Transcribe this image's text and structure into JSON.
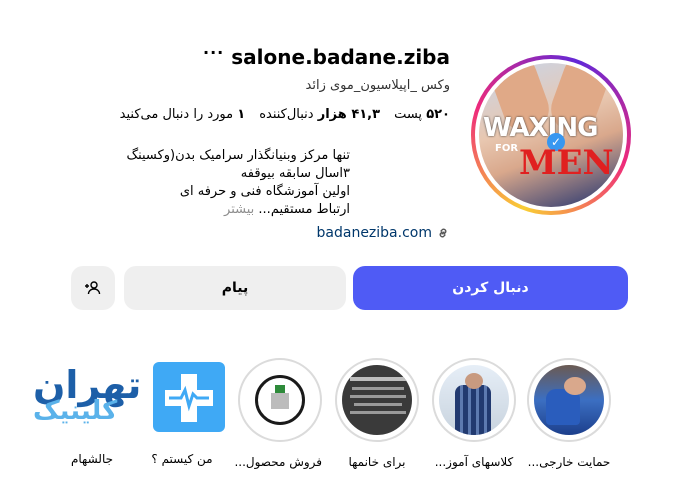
{
  "profile": {
    "username": "salone.badane.ziba",
    "more_icon": "ellipsis-icon",
    "category": "وکس _اپیلاسیون_موی زائد",
    "stats": {
      "posts_num": "۵۲۰",
      "posts_label": "پست",
      "followers_num": "۴۱,۳ هزار",
      "followers_label": "دنبال‌کننده",
      "following_num": "۱",
      "following_label": "مورد را دنبال می‌کنید"
    },
    "bio": {
      "line1": "تنها مرکز وبنیانگذار سرامیک بدن(وکسینگ",
      "line2": "۳اسال سابقه بیوقفه",
      "line3": "اولین آموزشگاه فنی و حرفه ای",
      "line4": "ارتباط مستقیم...",
      "more_label": "بیشتر"
    },
    "website": "badaneziba.com",
    "avatar": {
      "text_waxing": "WAXING",
      "text_for": "FOR",
      "text_men": "MEN"
    }
  },
  "actions": {
    "follow_label": "دنبال کردن",
    "message_label": "پیام",
    "suggest_icon": "add-person-icon"
  },
  "highlights": [
    {
      "label": "حمایت خارجی..."
    },
    {
      "label": "کلاسهای آموز..."
    },
    {
      "label": "برای خانمها"
    },
    {
      "label": "فروش محصول..."
    },
    {
      "label": "من کیستم ؟"
    },
    {
      "label": "جالشهام"
    }
  ],
  "watermark": {
    "line1": "تهران",
    "line2": "کلینیک"
  },
  "colors": {
    "primary_button": "#4f5bf5",
    "secondary_button": "#efefef",
    "link": "#00376b"
  }
}
